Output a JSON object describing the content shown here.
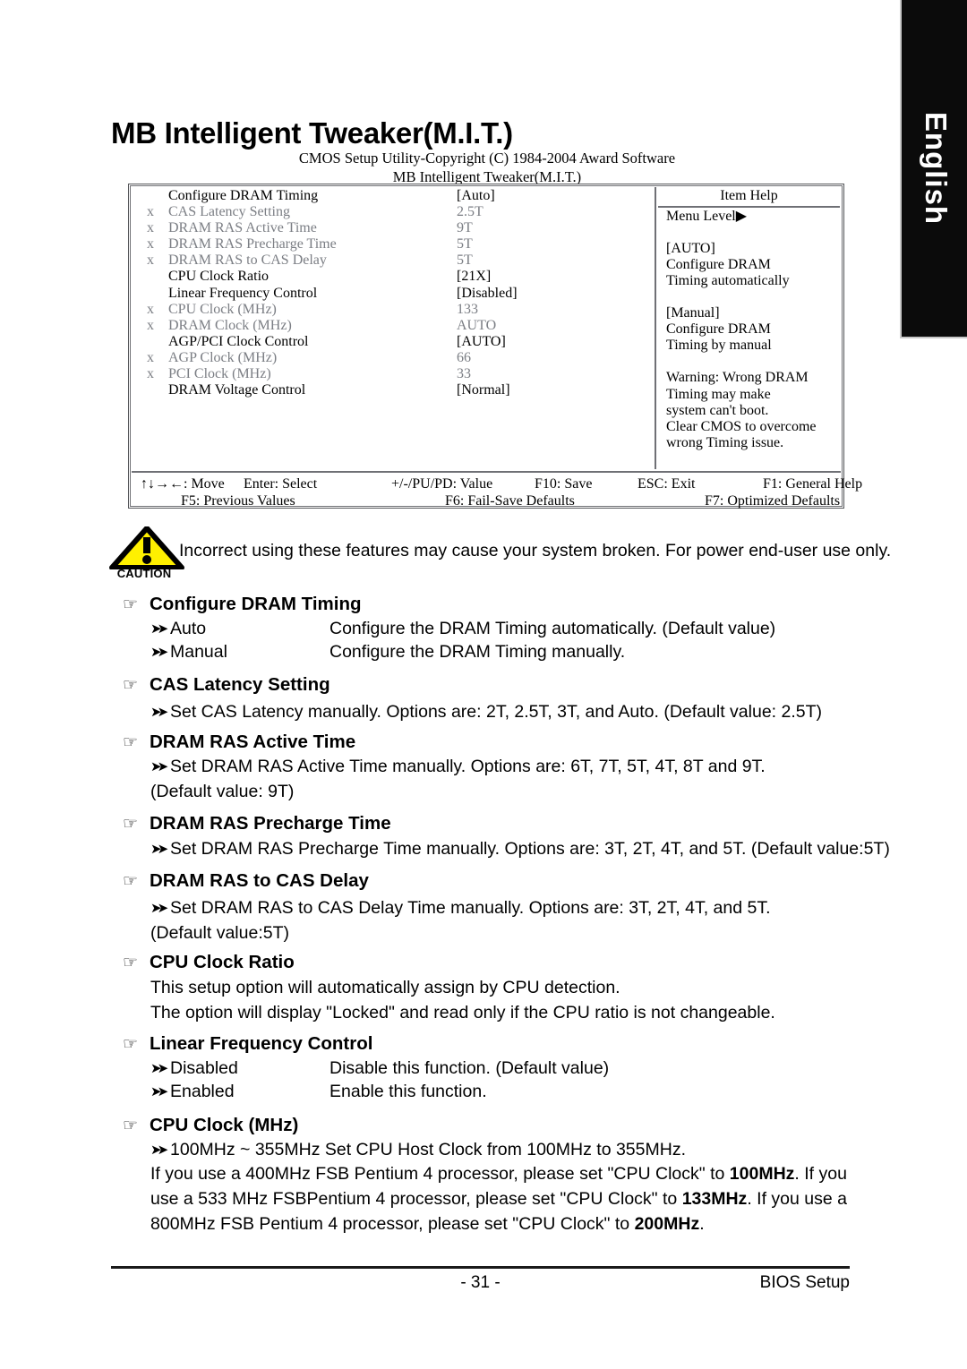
{
  "language_tab": {
    "label": "English"
  },
  "page_title": "MB Intelligent Tweaker(M.I.T.)",
  "bios": {
    "caption_line1": "CMOS Setup Utility-Copyright (C) 1984-2004 Award Software",
    "caption_line2": "MB Intelligent Tweaker(M.I.T.)",
    "rows": [
      {
        "x": "",
        "label": "Configure DRAM Timing",
        "value": "[Auto]",
        "dim": false
      },
      {
        "x": "x",
        "label": "CAS Latency Setting",
        "value": "2.5T",
        "dim": true
      },
      {
        "x": "x",
        "label": "DRAM RAS Active Time",
        "value": "9T",
        "dim": true
      },
      {
        "x": "x",
        "label": "DRAM RAS Precharge Time",
        "value": "5T",
        "dim": true
      },
      {
        "x": "x",
        "label": "DRAM RAS to CAS Delay",
        "value": "5T",
        "dim": true
      },
      {
        "x": "",
        "label": "CPU Clock Ratio",
        "value": "[21X]",
        "dim": false
      },
      {
        "x": "",
        "label": "Linear Frequency Control",
        "value": "[Disabled]",
        "dim": false
      },
      {
        "x": "x",
        "label": "CPU Clock (MHz)",
        "value": "133",
        "dim": true
      },
      {
        "x": "x",
        "label": "DRAM Clock (MHz)",
        "value": "AUTO",
        "dim": true
      },
      {
        "x": "",
        "label": "AGP/PCI Clock Control",
        "value": "[AUTO]",
        "dim": false
      },
      {
        "x": "x",
        "label": "AGP Clock (MHz)",
        "value": "66",
        "dim": true
      },
      {
        "x": "x",
        "label": "PCI Clock (MHz)",
        "value": "33",
        "dim": true
      },
      {
        "x": "",
        "label": "DRAM Voltage Control",
        "value": "[Normal]",
        "dim": false
      }
    ],
    "help": {
      "title": "Item Help",
      "lines": [
        "Menu Level▶",
        "",
        "[AUTO]",
        "Configure DRAM",
        "Timing automatically",
        "",
        "[Manual]",
        "Configure DRAM",
        "Timing by manual",
        "",
        "Warning: Wrong DRAM",
        "Timing may make",
        "system can't boot.",
        "Clear CMOS to overcome",
        "wrong Timing issue."
      ]
    },
    "keys_row1": [
      "↑↓→←: Move",
      "Enter: Select",
      "+/-/PU/PD: Value",
      "F10: Save",
      "ESC: Exit",
      "F1: General Help"
    ],
    "keys_row2": [
      "F5: Previous Values",
      "F6: Fail-Save Defaults",
      "F7: Optimized Defaults"
    ]
  },
  "caution": {
    "label": "CAUTION",
    "text": "Incorrect using these features may cause your system broken. For power end-user use only.",
    "triangle_color": "#FFF000"
  },
  "sections": [
    {
      "title": "Configure DRAM Timing",
      "options": [
        {
          "term": "Auto",
          "desc": "Configure the DRAM Timing automatically. (Default value)"
        },
        {
          "term": "Manual",
          "desc": "Configure the DRAM Timing manually."
        }
      ]
    },
    {
      "title": "CAS Latency Setting",
      "lines": [
        "Set CAS Latency manually. Options are: 2T, 2.5T, 3T, and Auto. (Default value: 2.5T)"
      ]
    },
    {
      "title": "DRAM RAS Active Time",
      "lines": [
        "Set DRAM RAS Active Time manually. Options are: 6T, 7T, 5T, 4T, 8T and 9T.",
        "(Default value: 9T)"
      ]
    },
    {
      "title": "DRAM RAS Precharge Time",
      "lines": [
        "Set DRAM RAS Precharge Time manually. Options are: 3T, 2T, 4T, and 5T. (Default value:5T)"
      ]
    },
    {
      "title": "DRAM RAS to CAS Delay",
      "lines": [
        "Set DRAM RAS to CAS Delay Time manually. Options are: 3T, 2T, 4T, and 5T.",
        " (Default value:5T)"
      ]
    },
    {
      "title": "CPU Clock Ratio",
      "lines": [
        "This setup option will automatically assign by CPU detection.",
        "The option will display \"Locked\" and read only if the CPU ratio is not changeable."
      ]
    },
    {
      "title": "Linear Frequency Control",
      "options": [
        {
          "term": "Disabled",
          "desc": "Disable this function. (Default value)"
        },
        {
          "term": "Enabled",
          "desc": "Enable this function."
        }
      ]
    },
    {
      "title": "CPU Clock (MHz)",
      "lines": [
        "100MHz ~ 355MHz       Set CPU Host Clock from 100MHz to 355MHz."
      ],
      "paragraph_parts": [
        {
          "text": "If you use a 400MHz FSB Pentium 4 processor, please set \"CPU Clock\" to ",
          "bold": false
        },
        {
          "text": "100MHz",
          "bold": true
        },
        {
          "text": ". If you use a 533 MHz FSBPentium 4 processor, please set \"CPU Clock\" to ",
          "bold": false
        },
        {
          "text": "133MHz",
          "bold": true
        },
        {
          "text": ". If you use a 800MHz FSB Pentium 4 processor, please set \"CPU Clock\" to ",
          "bold": false
        },
        {
          "text": "200MHz",
          "bold": true
        },
        {
          "text": ".",
          "bold": false
        }
      ]
    }
  ],
  "footer": {
    "page_number": "- 31 -",
    "section_name": "BIOS Setup"
  }
}
